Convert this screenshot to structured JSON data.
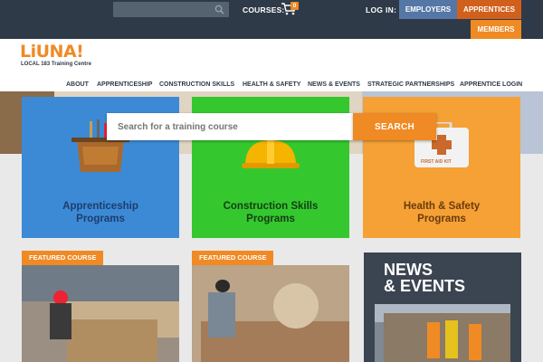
{
  "topbar": {
    "search_placeholder": "",
    "courses_label": "COURSES:",
    "cart_count": "0",
    "login_label": "LOG IN:",
    "employers": "EMPLOYERS",
    "apprentices": "APPRENTICES",
    "members": "MEMBERS"
  },
  "brand": {
    "logo": "LiUNA!",
    "sub": "LOCAL 183 Training Centre"
  },
  "nav": {
    "items": [
      "ABOUT",
      "APPRENTICESHIP",
      "CONSTRUCTION SKILLS",
      "HEALTH & SAFETY",
      "NEWS & EVENTS",
      "STRATEGIC PARTNERSHIPS",
      "APPRENTICE LOGIN"
    ]
  },
  "search": {
    "placeholder": "Search for a training course",
    "button": "SEARCH"
  },
  "programs": [
    {
      "line1": "Apprenticeship",
      "line2": "Programs"
    },
    {
      "line1": "Construction Skills",
      "line2": "Programs"
    },
    {
      "line1": "Health & Safety",
      "line2": "Programs"
    }
  ],
  "first_aid_label": "FIRST AID KIT",
  "featured": {
    "tag": "FEATURED COURSE"
  },
  "news": {
    "line1": "NEWS",
    "line2": "& EVENTS"
  },
  "colors": {
    "topbar": "#2f3a48",
    "orange": "#f08a24",
    "blue": "#3c8ad6",
    "green": "#34c82e",
    "amber": "#f5a136"
  }
}
